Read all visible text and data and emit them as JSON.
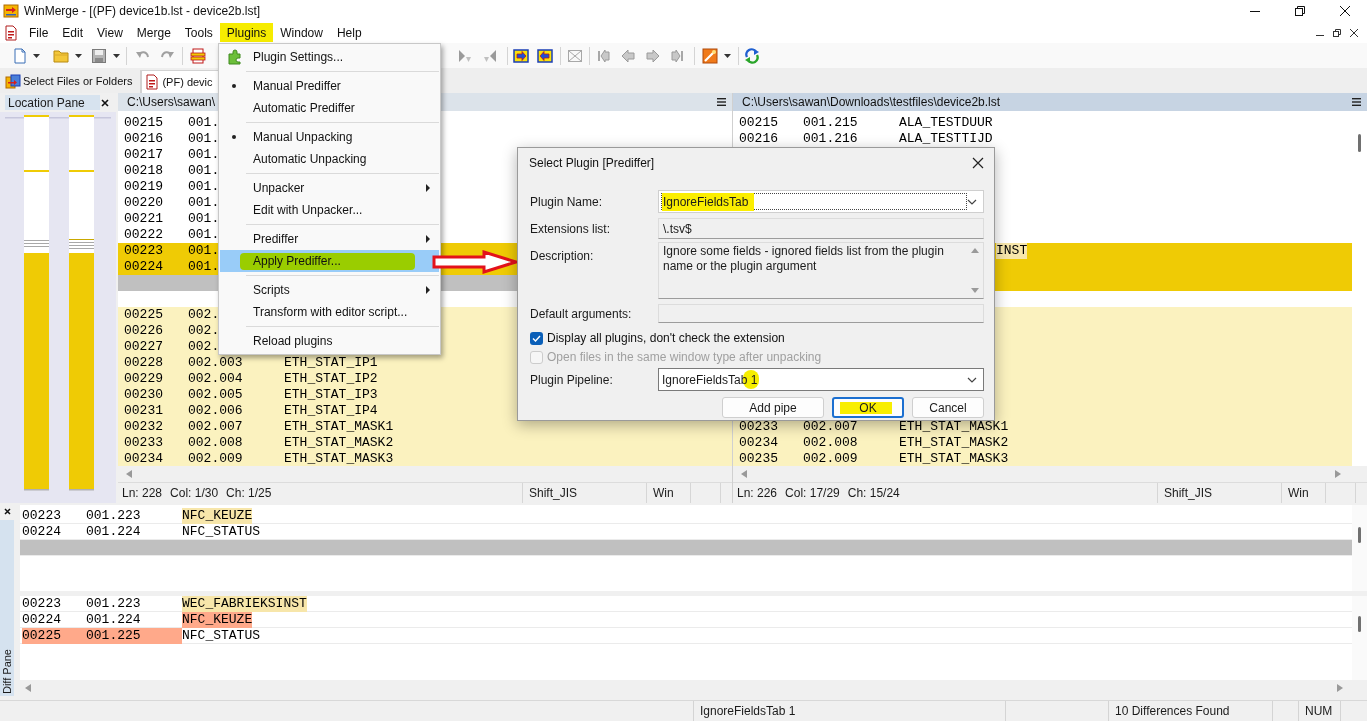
{
  "window": {
    "title": "WinMerge - [(PF) device1b.lst - device2b.lst]"
  },
  "menu_bar": [
    {
      "label": "File",
      "selected": false
    },
    {
      "label": "Edit",
      "selected": false
    },
    {
      "label": "View",
      "selected": false
    },
    {
      "label": "Merge",
      "selected": false
    },
    {
      "label": "Tools",
      "selected": false
    },
    {
      "label": "Plugins",
      "selected": true
    },
    {
      "label": "Window",
      "selected": false
    },
    {
      "label": "Help",
      "selected": false
    }
  ],
  "tabs": [
    {
      "label": "Select Files or Folders",
      "selected": false
    },
    {
      "label": "(PF) devic",
      "selected": true
    }
  ],
  "location_pane": {
    "title": "Location Pane"
  },
  "left_pane": {
    "path": "C:\\Users\\sawan\\",
    "active": false,
    "rows": [
      {
        "kind": "equal",
        "cells": [
          "00215",
          "001."
        ]
      },
      {
        "kind": "equal",
        "cells": [
          "00216",
          "001."
        ]
      },
      {
        "kind": "equal",
        "cells": [
          "00217",
          "001."
        ]
      },
      {
        "kind": "equal",
        "cells": [
          "00218",
          "001."
        ]
      },
      {
        "kind": "equal",
        "cells": [
          "00219",
          "001."
        ]
      },
      {
        "kind": "equal",
        "cells": [
          "00220",
          "001."
        ]
      },
      {
        "kind": "equal",
        "cells": [
          "00221",
          "001."
        ]
      },
      {
        "kind": "equal",
        "cells": [
          "00222",
          "001."
        ]
      },
      {
        "kind": "diff",
        "cells": [
          "00223",
          "001."
        ]
      },
      {
        "kind": "diff",
        "cells": [
          "00224",
          "001."
        ]
      },
      {
        "kind": "missing"
      },
      {
        "kind": "blank"
      },
      {
        "kind": "ignored",
        "cells": [
          "00225",
          "002."
        ]
      },
      {
        "kind": "ignored",
        "cells": [
          "00226",
          "002."
        ]
      },
      {
        "kind": "ignored",
        "cells": [
          "00227",
          "002."
        ]
      },
      {
        "kind": "ignored",
        "cells": [
          "00228",
          "002.003",
          "ETH_STAT_IP1"
        ]
      },
      {
        "kind": "ignored",
        "cells": [
          "00229",
          "002.004",
          "ETH_STAT_IP2"
        ]
      },
      {
        "kind": "ignored",
        "cells": [
          "00230",
          "002.005",
          "ETH_STAT_IP3"
        ]
      },
      {
        "kind": "ignored",
        "cells": [
          "00231",
          "002.006",
          "ETH_STAT_IP4"
        ]
      },
      {
        "kind": "ignored",
        "cells": [
          "00232",
          "002.007",
          "ETH_STAT_MASK1"
        ]
      },
      {
        "kind": "ignored",
        "cells": [
          "00233",
          "002.008",
          "ETH_STAT_MASK2"
        ]
      },
      {
        "kind": "ignored",
        "cells": [
          "00234",
          "002.009",
          "ETH_STAT_MASK3"
        ]
      }
    ],
    "status": {
      "position": [
        "Ln: 228",
        "Col: 1/30",
        "Ch: 1/25"
      ],
      "encoding": "Shift_JIS",
      "eol": "Win"
    }
  },
  "right_pane": {
    "path": "C:\\Users\\sawan\\Downloads\\testfiles\\device2b.lst",
    "active": true,
    "rows": [
      {
        "kind": "equal",
        "cells": [
          "00215",
          "001.215",
          "ALA_TESTDUUR"
        ]
      },
      {
        "kind": "equal",
        "cells": [
          "00216",
          "001.216",
          "ALA_TESTTIJD"
        ]
      },
      {
        "kind": "equal"
      },
      {
        "kind": "equal"
      },
      {
        "kind": "equal"
      },
      {
        "kind": "equal"
      },
      {
        "kind": "equal"
      },
      {
        "kind": "equal"
      },
      {
        "kind": "diff",
        "covered": true,
        "cells": [
          {
            "text": "INST",
            "kind": "word"
          }
        ]
      },
      {
        "kind": "diff"
      },
      {
        "kind": "diff"
      },
      {
        "kind": "blank"
      },
      {
        "kind": "ignored"
      },
      {
        "kind": "ignored"
      },
      {
        "kind": "ignored"
      },
      {
        "kind": "ignored"
      },
      {
        "kind": "ignored"
      },
      {
        "kind": "ignored"
      },
      {
        "kind": "ignored"
      },
      {
        "kind": "ignored",
        "cells": [
          "00233",
          "002.007",
          "ETH_STAT_MASK1"
        ]
      },
      {
        "kind": "ignored",
        "cells": [
          "00234",
          "002.008",
          "ETH_STAT_MASK2"
        ]
      },
      {
        "kind": "ignored",
        "cells": [
          "00235",
          "002.009",
          "ETH_STAT_MASK3"
        ]
      }
    ],
    "status": {
      "position": [
        "Ln: 226",
        "Col: 17/29",
        "Ch: 15/24"
      ],
      "encoding": "Shift_JIS",
      "eol": "Win"
    }
  },
  "plugins_menu": [
    {
      "kind": "icon_item",
      "label": "Plugin Settings...",
      "checked": false,
      "selected": false
    },
    {
      "kind": "separator"
    },
    {
      "kind": "item",
      "label": "Manual Prediffer",
      "checked": true,
      "selected": false
    },
    {
      "kind": "item",
      "label": "Automatic Prediffer",
      "checked": false,
      "selected": false
    },
    {
      "kind": "separator"
    },
    {
      "kind": "item",
      "label": "Manual Unpacking",
      "checked": true,
      "selected": false
    },
    {
      "kind": "item",
      "label": "Automatic Unpacking",
      "checked": false,
      "selected": false
    },
    {
      "kind": "separator"
    },
    {
      "kind": "submenu",
      "label": "Unpacker",
      "checked": false,
      "selected": false
    },
    {
      "kind": "item",
      "label": "Edit with Unpacker...",
      "checked": false,
      "selected": false
    },
    {
      "kind": "separator"
    },
    {
      "kind": "submenu",
      "label": "Prediffer",
      "checked": false,
      "selected": false
    },
    {
      "kind": "item",
      "label": "Apply Prediffer...",
      "checked": false,
      "selected": true
    },
    {
      "kind": "separator"
    },
    {
      "kind": "submenu",
      "label": "Scripts",
      "checked": false,
      "selected": false
    },
    {
      "kind": "item",
      "label": "Transform with editor script...",
      "checked": false,
      "selected": false
    },
    {
      "kind": "separator"
    },
    {
      "kind": "item",
      "label": "Reload plugins",
      "checked": false,
      "selected": false
    }
  ],
  "dialog": {
    "title": "Select Plugin [Prediffer]",
    "plugin_name": {
      "label": "Plugin Name:",
      "value": "IgnoreFieldsTab",
      "highlighted": true
    },
    "extensions": {
      "label": "Extensions list:",
      "value": "\\.tsv$"
    },
    "description": {
      "label": "Description:",
      "value": "Ignore some fields - ignored fields list from the plugin name or the plugin argument"
    },
    "default_arguments": {
      "label": "Default arguments:"
    },
    "options": [
      {
        "label": "Display all plugins, don't check the extension",
        "checked": true,
        "disabled": false
      },
      {
        "label": "Open files in the same window type after unpacking",
        "checked": false,
        "disabled": true
      }
    ],
    "pipeline": {
      "label": "Plugin Pipeline:",
      "value": "IgnoreFieldsTab 1",
      "highlighted": true
    },
    "buttons": [
      {
        "label": "Add pipe",
        "default": false,
        "highlighted": false
      },
      {
        "label": "OK",
        "default": true,
        "highlighted": true
      },
      {
        "label": "Cancel",
        "default": false,
        "highlighted": false
      }
    ]
  },
  "diff_pane": {
    "title": "Diff Pane",
    "upper": [
      {
        "kind": "equal",
        "cells": [
          "00223",
          "001.223",
          {
            "text": "NFC_KEUZE",
            "kind": "word"
          }
        ]
      },
      {
        "kind": "equal",
        "cells": [
          "00224",
          "001.224",
          "NFC_STATUS"
        ]
      },
      {
        "kind": "missing"
      }
    ],
    "lower": [
      {
        "kind": "equal",
        "cells": [
          "00223",
          "001.223",
          {
            "text": "WEC_FABRIEKSINST",
            "kind": "word"
          }
        ]
      },
      {
        "kind": "equal",
        "cells": [
          "00224",
          "001.224",
          {
            "text": "NFC_KEUZE",
            "kind": "changed"
          }
        ]
      },
      {
        "kind": "equal",
        "cells": [
          {
            "text": "00225",
            "kind": "changed"
          },
          {
            "text": "001.225",
            "kind": "changed"
          },
          "NFC_STATUS"
        ]
      }
    ]
  },
  "status_bar": [
    "IgnoreFieldsTab 1",
    "10 Differences Found",
    "NUM"
  ]
}
